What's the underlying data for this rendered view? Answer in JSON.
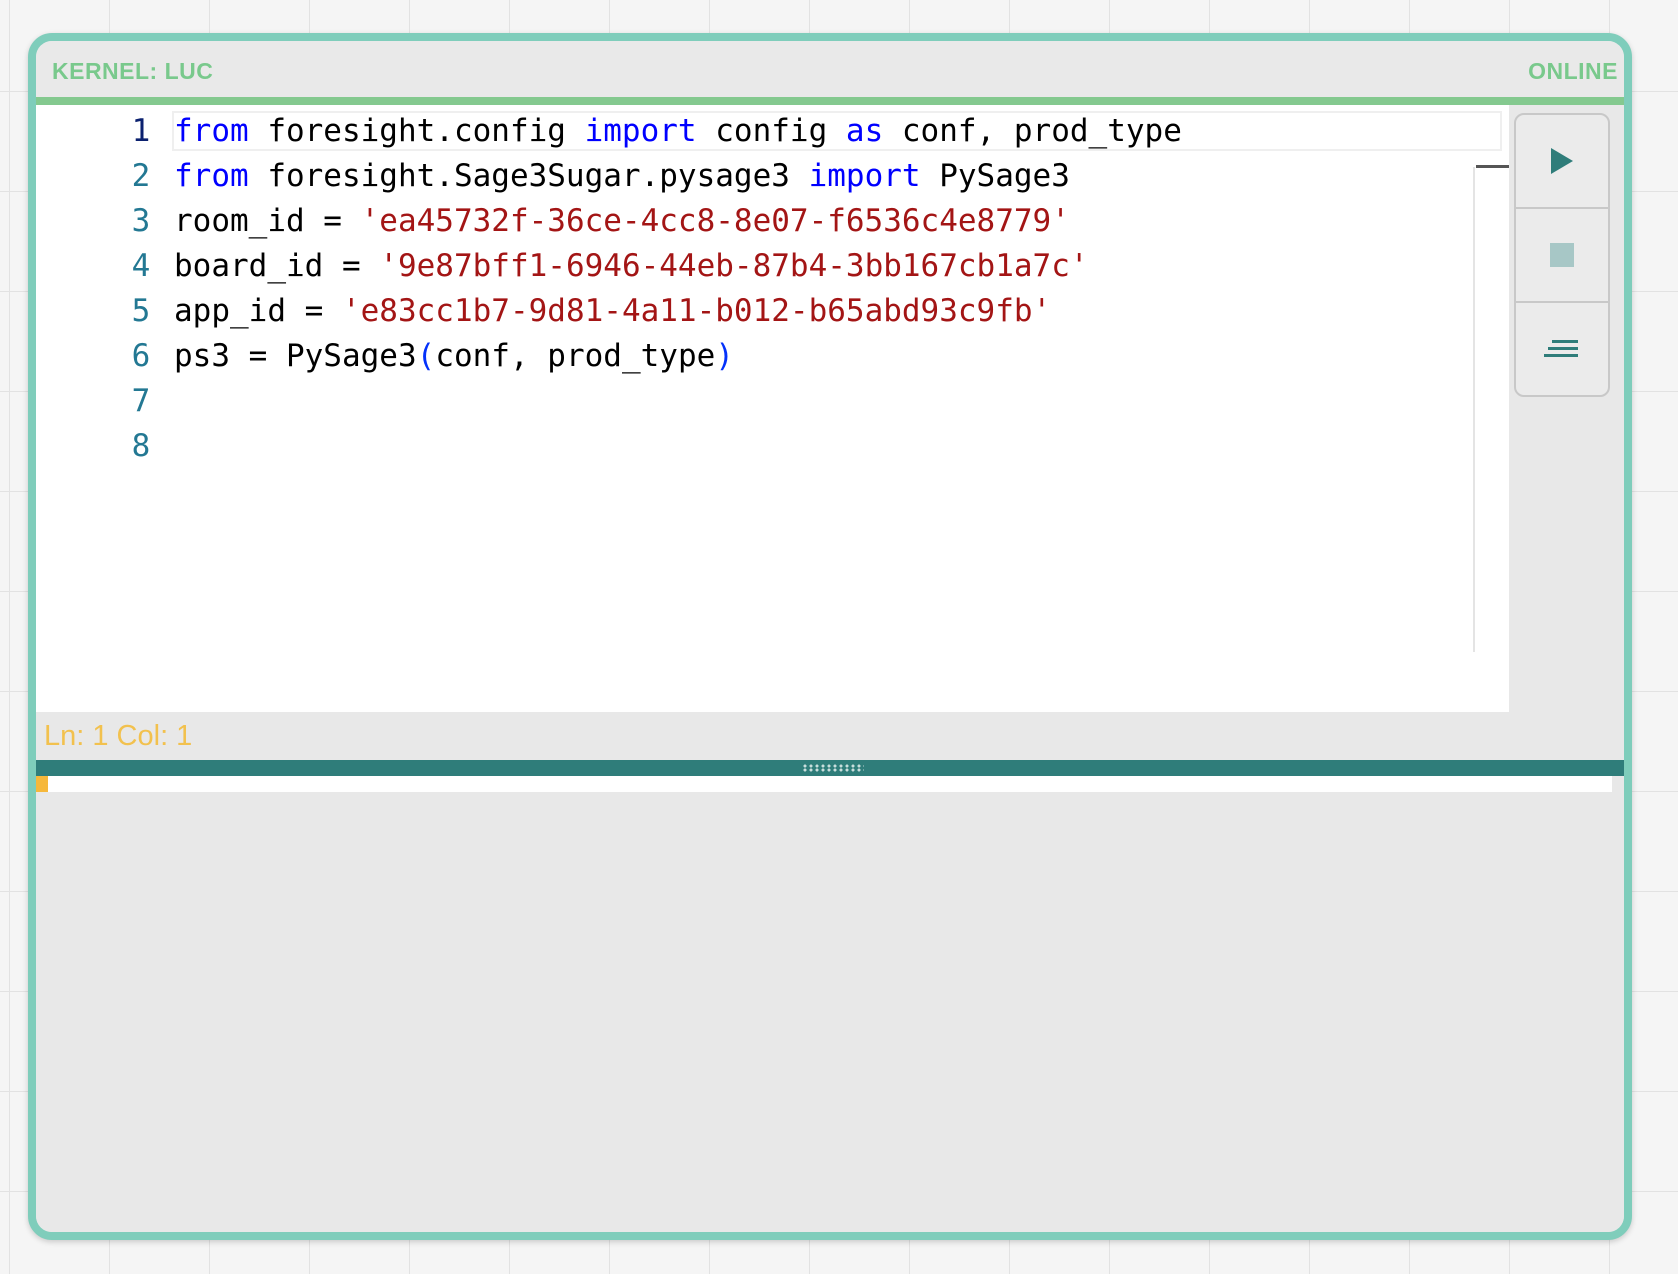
{
  "window": {
    "kernel_label": "KERNEL: LUC",
    "status": "ONLINE"
  },
  "editor": {
    "lines": [
      {
        "number": "1",
        "active": true,
        "tokens": [
          [
            "kw",
            "from"
          ],
          [
            "t",
            " foresight.config "
          ],
          [
            "kw",
            "import"
          ],
          [
            "t",
            " config "
          ],
          [
            "kw",
            "as"
          ],
          [
            "t",
            " conf, prod_type"
          ]
        ]
      },
      {
        "number": "2",
        "active": false,
        "tokens": [
          [
            "kw",
            "from"
          ],
          [
            "t",
            " foresight.Sage3Sugar.pysage3 "
          ],
          [
            "kw",
            "import"
          ],
          [
            "t",
            " PySage3"
          ]
        ]
      },
      {
        "number": "3",
        "active": false,
        "tokens": [
          [
            "t",
            "room_id = "
          ],
          [
            "str",
            "'ea45732f-36ce-4cc8-8e07-f6536c4e8779'"
          ]
        ]
      },
      {
        "number": "4",
        "active": false,
        "tokens": [
          [
            "t",
            "board_id = "
          ],
          [
            "str",
            "'9e87bff1-6946-44eb-87b4-3bb167cb1a7c'"
          ]
        ]
      },
      {
        "number": "5",
        "active": false,
        "tokens": [
          [
            "t",
            "app_id = "
          ],
          [
            "str",
            "'e83cc1b7-9d81-4a11-b012-b65abd93c9fb'"
          ]
        ]
      },
      {
        "number": "6",
        "active": false,
        "tokens": [
          [
            "t",
            "ps3 = PySage3"
          ],
          [
            "br",
            "("
          ],
          [
            "t",
            "conf, prod_type"
          ],
          [
            "br",
            ")"
          ]
        ]
      },
      {
        "number": "7",
        "active": false,
        "tokens": []
      },
      {
        "number": "8",
        "active": false,
        "tokens": []
      }
    ]
  },
  "toolbar": {
    "buttons": [
      {
        "name": "run-button",
        "icon": "play-icon"
      },
      {
        "name": "stop-button",
        "icon": "stop-icon"
      },
      {
        "name": "clear-button",
        "icon": "clear-lines-icon"
      }
    ]
  },
  "status_bar": {
    "cursor_position": "Ln: 1 Col: 1"
  },
  "colors": {
    "frame": "#7fcdbb",
    "title_text": "#79c98c",
    "accent": "#2f7d7a",
    "cursor_status": "#f2c14e",
    "keyword": "#0000ff",
    "string": "#a31515",
    "line_number": "#237893"
  }
}
